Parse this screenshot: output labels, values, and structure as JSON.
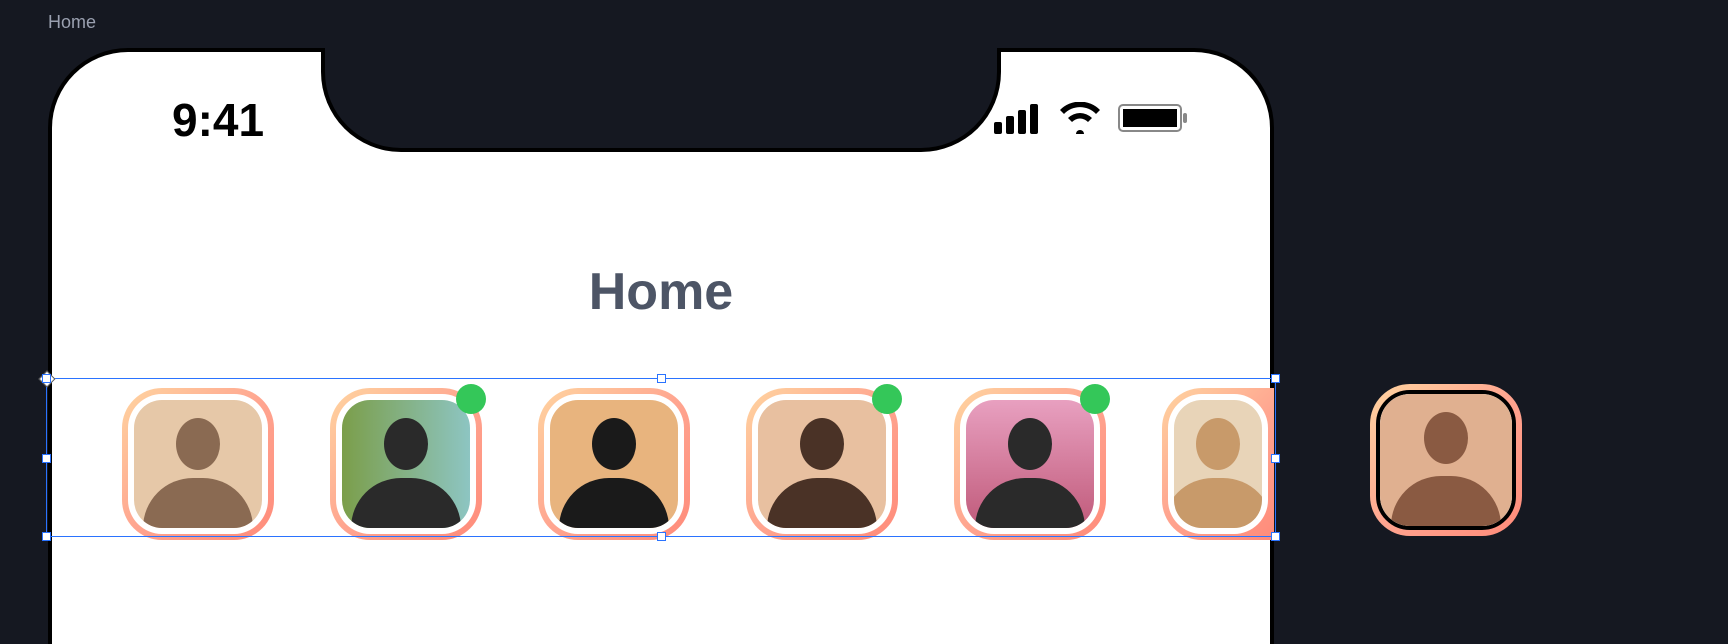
{
  "breadcrumb": "Home",
  "status": {
    "time": "9:41",
    "signal_icon": "cellular-signal-icon",
    "wifi_icon": "wifi-icon",
    "battery_icon": "battery-full-icon"
  },
  "page": {
    "title": "Home"
  },
  "avatars": [
    {
      "name": "avatar-1",
      "online": false
    },
    {
      "name": "avatar-2",
      "online": true
    },
    {
      "name": "avatar-3",
      "online": false
    },
    {
      "name": "avatar-4",
      "online": true
    },
    {
      "name": "avatar-5",
      "online": true
    },
    {
      "name": "avatar-6",
      "online": false
    }
  ],
  "floating_avatar": {
    "name": "avatar-7",
    "online": false
  },
  "selection": {
    "target": "avatar-row",
    "handles": [
      "tl",
      "tm",
      "tr",
      "lm",
      "rm",
      "bl",
      "bm",
      "br"
    ]
  }
}
